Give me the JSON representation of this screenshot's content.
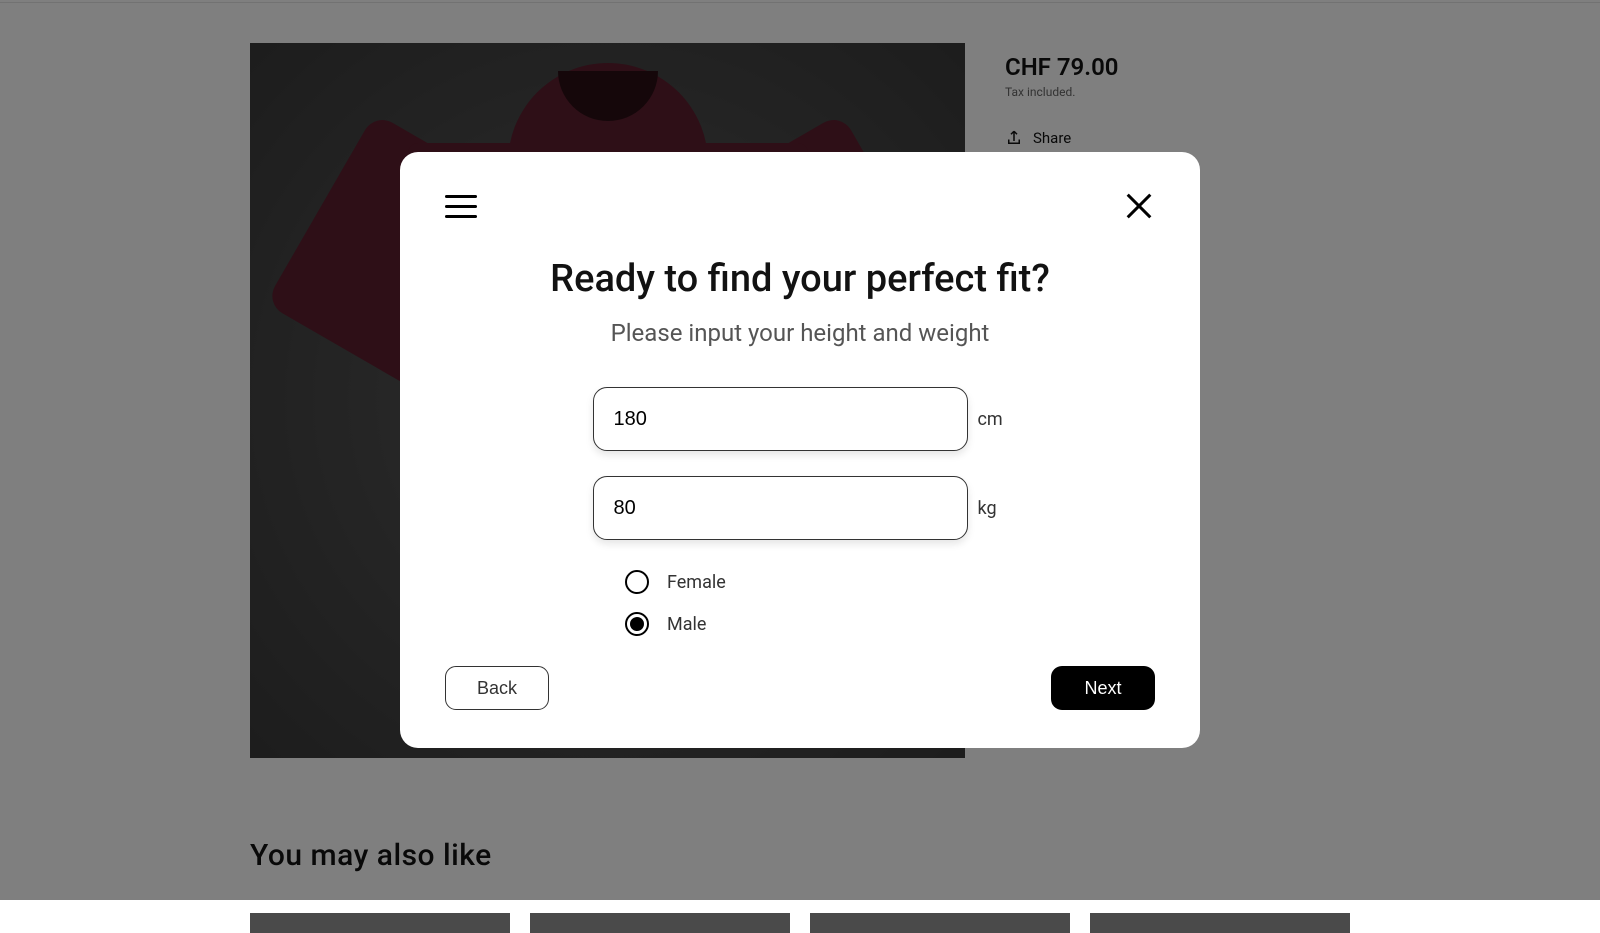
{
  "product": {
    "price": "CHF 79.00",
    "tax_info": "Tax included.",
    "share_label": "Share"
  },
  "related": {
    "title": "You may also like"
  },
  "modal": {
    "title": "Ready to find your perfect fit?",
    "subtitle": "Please input your height and weight",
    "height_value": "180",
    "height_unit": "cm",
    "weight_value": "80",
    "weight_unit": "kg",
    "gender_female": "Female",
    "gender_male": "Male",
    "selected_gender": "male",
    "back_label": "Back",
    "next_label": "Next"
  }
}
